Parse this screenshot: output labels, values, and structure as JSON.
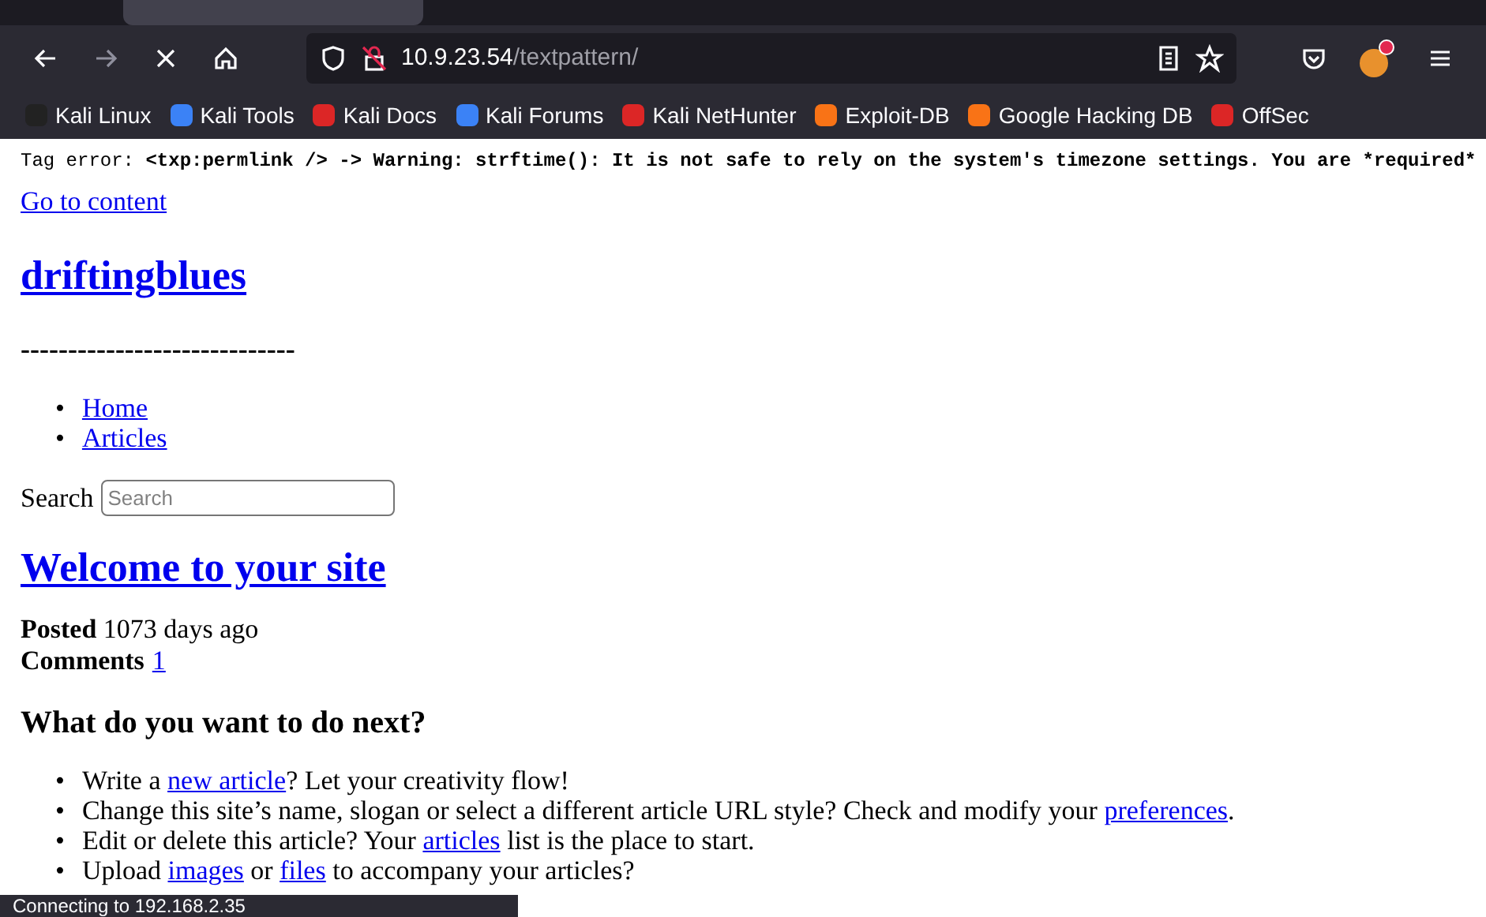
{
  "toolbar": {
    "url_host": "10.9.23.54",
    "url_path": "/textpattern/"
  },
  "bookmarks": [
    {
      "label": "Kali Linux",
      "color": "#222222"
    },
    {
      "label": "Kali Tools",
      "color": "#3b82f6"
    },
    {
      "label": "Kali Docs",
      "color": "#dc2626"
    },
    {
      "label": "Kali Forums",
      "color": "#3b82f6"
    },
    {
      "label": "Kali NetHunter",
      "color": "#dc2626"
    },
    {
      "label": "Exploit-DB",
      "color": "#f97316"
    },
    {
      "label": "Google Hacking DB",
      "color": "#f97316"
    },
    {
      "label": "OffSec",
      "color": "#dc2626"
    }
  ],
  "page": {
    "error_prefix": "Tag error: ",
    "error_body": "<txp:permlink /> ->  Warning: strftime(): It is not safe to rely on the system's timezone settings. You are *required*",
    "skip_link": "Go to content",
    "site_title": "driftingblues",
    "slogan": "-----------------------------",
    "marker": "•",
    "nav": [
      "Home",
      "Articles"
    ],
    "search_label": "Search",
    "search_placeholder": "Search",
    "article_title": "Welcome to your site",
    "posted_label": "Posted",
    "posted_value": "1073 days ago",
    "comments_label": "Comments",
    "comments_value": "1",
    "next_heading": "What do you want to do next?",
    "next_items": [
      [
        {
          "kind": "text",
          "t": "Write a "
        },
        {
          "kind": "link",
          "t": "new article"
        },
        {
          "kind": "text",
          "t": "? Let your creativity flow!"
        }
      ],
      [
        {
          "kind": "text",
          "t": "Change this site’s name, slogan or select a different article URL style? Check and modify your "
        },
        {
          "kind": "link",
          "t": "preferences"
        },
        {
          "kind": "text",
          "t": "."
        }
      ],
      [
        {
          "kind": "text",
          "t": "Edit or delete this article? Your "
        },
        {
          "kind": "link",
          "t": "articles"
        },
        {
          "kind": "text",
          "t": " list is the place to start."
        }
      ],
      [
        {
          "kind": "text",
          "t": "Upload "
        },
        {
          "kind": "link",
          "t": "images"
        },
        {
          "kind": "text",
          "t": " or "
        },
        {
          "kind": "link",
          "t": "files"
        },
        {
          "kind": "text",
          "t": " to accompany your articles?"
        }
      ]
    ]
  },
  "status": "Connecting to 192.168.2.35"
}
